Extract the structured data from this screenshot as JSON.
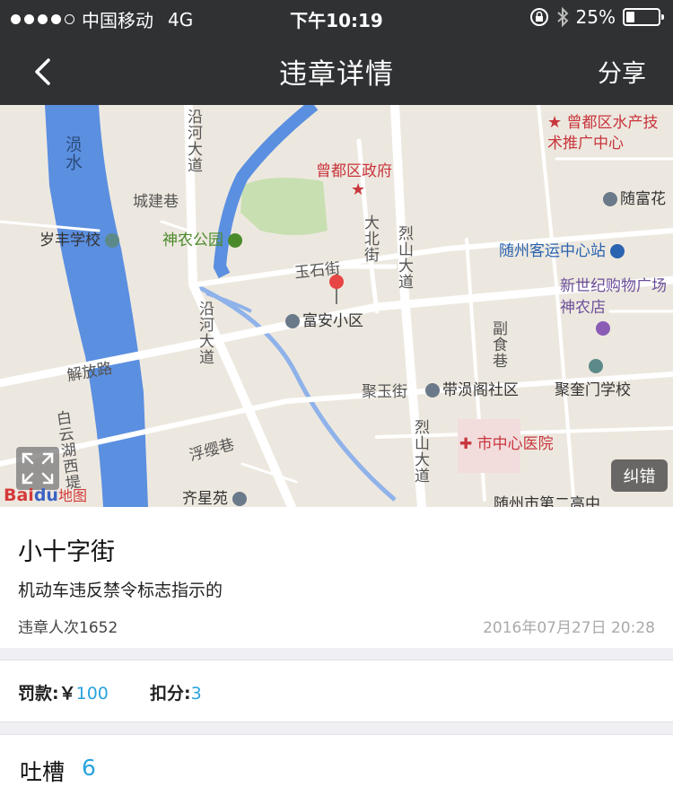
{
  "status": {
    "carrier": "中国移动",
    "network": "4G",
    "time": "下午10:19",
    "battery": "25%",
    "battery_level": 0.25
  },
  "nav": {
    "title": "违章详情",
    "share_label": "分享"
  },
  "map": {
    "labels": {
      "river": "涢水",
      "chengjian": "城建巷",
      "suifeng": "岁丰学校",
      "shennong_park": "神农公园",
      "yanhe1": "沿河大道",
      "yanhe2": "沿河大道",
      "zengdu_gov": "曾都区政府",
      "shuichan": "曾都区水产技术推广中心",
      "suifu": "随富花",
      "keyun": "随州客运中心站",
      "xinshiji": "新世纪购物广场神农店",
      "dabei": "大北街",
      "lieshan1": "烈山大道",
      "lieshan2": "烈山大道",
      "yushi": "玉石街",
      "fuan": "富安小区",
      "fushi": "副食巷",
      "jiefang": "解放路",
      "juyu": "聚玉街",
      "daiyunge": "带涢阁社区",
      "jukuimen": "聚奎门学校",
      "baiyunhu": "白云湖西堤",
      "fuying": "浮缨巷",
      "hospital": "市中心医院",
      "qixing": "齐星苑",
      "dier": "随州市第二高中"
    },
    "correct_label": "纠错",
    "logo_bai": "Bai",
    "logo_du": "du",
    "logo_map": "地图"
  },
  "detail": {
    "street": "小十字街",
    "violation": "机动车违反禁令标志指示的",
    "count": "违章人次1652",
    "date": "2016年07月27日 20:28"
  },
  "fine": {
    "fine_label": "罚款:￥",
    "fine_value": "100",
    "points_label": "扣分:",
    "points_value": "3"
  },
  "comments": {
    "label": "吐槽",
    "count": "6"
  },
  "colors": {
    "accent": "#2aa3df",
    "header": "#2f3133",
    "map_bg": "#ede8df",
    "river": "#5b8fe0",
    "pin": "#e84545"
  }
}
